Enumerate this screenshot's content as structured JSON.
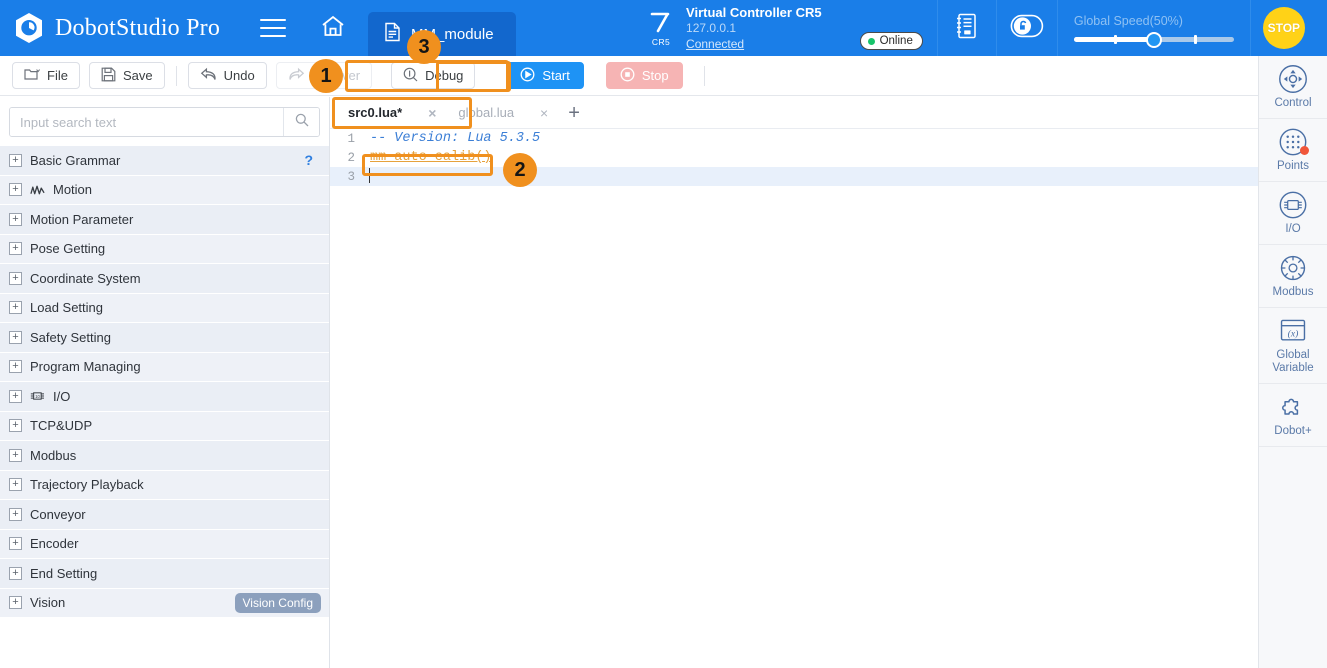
{
  "header": {
    "brand": "DobotStudio Pro",
    "menu_icon": "hamburger-icon",
    "home_icon": "home-icon",
    "module_tab": {
      "label": "MM_module",
      "icon": "file-icon"
    },
    "controller": {
      "robot_model": "CR5",
      "title": "Virtual Controller CR5",
      "ip": "127.0.0.1",
      "connection": "Connected",
      "status_badge": "Online"
    },
    "log_icon": "log-book-icon",
    "lock_icon": "unlock-toggle-icon",
    "speed": {
      "label": "Global Speed(50%)",
      "value": 50
    },
    "stop_button": "STOP",
    "colors": {
      "header_blue": "#1a7ee8",
      "tab_blue": "#1267cd",
      "stop_yellow": "#ffd217",
      "online_green": "#17c46b"
    }
  },
  "toolbar": {
    "buttons": [
      {
        "label": "File",
        "icon": "folder-dropdown-icon",
        "state": "enabled"
      },
      {
        "label": "Save",
        "icon": "floppy-icon",
        "state": "enabled"
      },
      {
        "label": "Undo",
        "icon": "undo-arrow-icon",
        "state": "enabled"
      },
      {
        "label": "Recover",
        "icon": "redo-arrow-icon",
        "state": "disabled"
      },
      {
        "label": "Debug",
        "icon": "magnifier-debug-icon",
        "state": "enabled"
      },
      {
        "label": "Start",
        "icon": "play-circle-icon",
        "state": "primary"
      },
      {
        "label": "Stop",
        "icon": "stop-circle-icon",
        "state": "disabled"
      }
    ]
  },
  "sidebar": {
    "search": {
      "placeholder": "Input search text",
      "value": "",
      "icon": "search-icon"
    },
    "items": [
      {
        "label": "Basic Grammar",
        "icon": null,
        "help": "?"
      },
      {
        "label": "Motion",
        "icon": "motion-wave-icon",
        "help": null
      },
      {
        "label": "Motion Parameter",
        "icon": null,
        "help": null
      },
      {
        "label": "Pose Getting",
        "icon": null,
        "help": null
      },
      {
        "label": "Coordinate System",
        "icon": null,
        "help": null
      },
      {
        "label": "Load Setting",
        "icon": null,
        "help": null
      },
      {
        "label": "Safety Setting",
        "icon": null,
        "help": null
      },
      {
        "label": "Program Managing",
        "icon": null,
        "help": null
      },
      {
        "label": "I/O",
        "icon": "io-chip-icon",
        "help": null
      },
      {
        "label": "TCP&UDP",
        "icon": null,
        "help": null
      },
      {
        "label": "Modbus",
        "icon": null,
        "help": null
      },
      {
        "label": "Trajectory Playback",
        "icon": null,
        "help": null
      },
      {
        "label": "Conveyor",
        "icon": null,
        "help": null
      },
      {
        "label": "Encoder",
        "icon": null,
        "help": null
      },
      {
        "label": "End Setting",
        "icon": null,
        "help": null
      },
      {
        "label": "Vision",
        "icon": null,
        "help": null,
        "tooltip": "Vision Config"
      }
    ],
    "expander_glyph": "+"
  },
  "editor": {
    "tabs": [
      {
        "label": "src0.lua*",
        "active": true,
        "close": "×"
      },
      {
        "label": "global.lua",
        "active": false,
        "close": "×"
      }
    ],
    "add_tab": "+",
    "lines": [
      {
        "no": "1",
        "text": "-- Version: Lua 5.3.5",
        "style": "comment",
        "active": false
      },
      {
        "no": "2",
        "text": "mm_auto_calib()",
        "style": "function",
        "active": false
      },
      {
        "no": "3",
        "text": "",
        "style": "plain",
        "active": true
      }
    ]
  },
  "rail": {
    "items": [
      {
        "label": "Control",
        "icon": "dpad-control-icon",
        "badge": false
      },
      {
        "label": "Points",
        "icon": "points-grid-icon",
        "badge": true
      },
      {
        "label": "I/O",
        "icon": "io-module-icon",
        "badge": false
      },
      {
        "label": "Modbus",
        "icon": "modbus-hub-icon",
        "badge": false
      },
      {
        "label": "Global\nVariable",
        "icon": "variable-xy-icon",
        "badge": false
      },
      {
        "label": "Dobot+",
        "icon": "puzzle-piece-icon",
        "badge": false
      }
    ]
  },
  "annotations": {
    "accent": "#f0901e",
    "badges": [
      {
        "n": "1",
        "target": "toolbar"
      },
      {
        "n": "2",
        "target": "code-line-2"
      },
      {
        "n": "3",
        "target": "start-button"
      }
    ]
  }
}
